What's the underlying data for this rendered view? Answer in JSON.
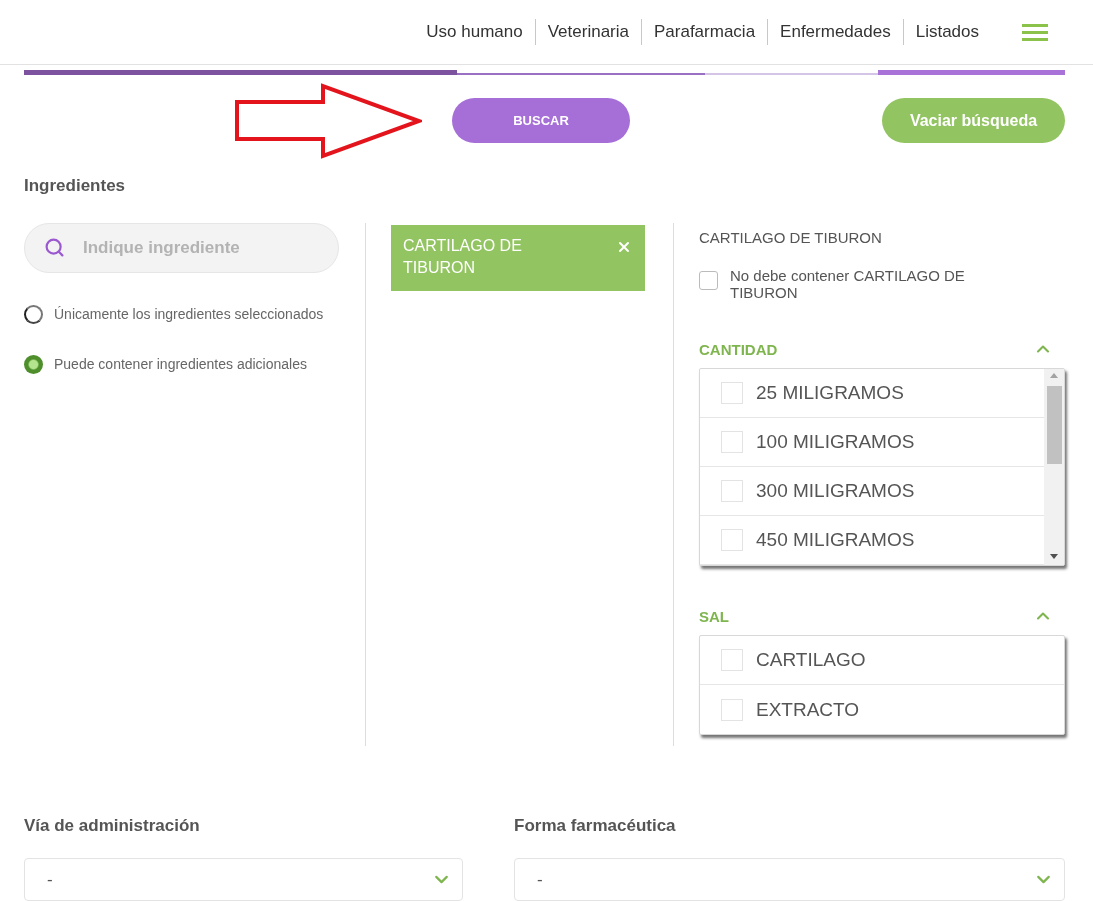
{
  "header": {
    "nav": [
      {
        "label": "Uso humano"
      },
      {
        "label": "Veterinaria"
      },
      {
        "label": "Parafarmacia"
      },
      {
        "label": "Enfermedades"
      },
      {
        "label": "Listados"
      }
    ]
  },
  "tab_strip": [
    {
      "selected": true,
      "color": "#7d539f"
    },
    {
      "selected": false,
      "color": "#9a70c2"
    },
    {
      "selected": false,
      "color": "#d4c4e6"
    },
    {
      "selected": true,
      "color": "#a872d8"
    }
  ],
  "actions": {
    "search_button": "BUSCAR",
    "clear_button": "Vaciar búsqueda"
  },
  "ingredients": {
    "title": "Ingredientes",
    "search": {
      "placeholder": "Indique ingrediente"
    },
    "match_options": [
      {
        "label": "Únicamente los ingredientes seleccionados",
        "selected": false
      },
      {
        "label": "Puede contener ingredientes adicionales",
        "selected": true
      }
    ],
    "chips": [
      {
        "label": "CARTILAGO DE TIBURON"
      }
    ],
    "detail": {
      "title": "CARTILAGO DE TIBURON",
      "exclude": {
        "label": "No debe contener CARTILAGO DE TIBURON",
        "checked": false
      },
      "groups": [
        {
          "title": "CANTIDAD",
          "expanded": true,
          "scrollable": true,
          "options": [
            {
              "label": "25 MILIGRAMOS",
              "checked": false
            },
            {
              "label": "100 MILIGRAMOS",
              "checked": false
            },
            {
              "label": "300 MILIGRAMOS",
              "checked": false
            },
            {
              "label": "450 MILIGRAMOS",
              "checked": false
            }
          ]
        },
        {
          "title": "SAL",
          "expanded": true,
          "scrollable": false,
          "options": [
            {
              "label": "CARTILAGO",
              "checked": false
            },
            {
              "label": "EXTRACTO",
              "checked": false
            }
          ]
        }
      ]
    }
  },
  "filters": [
    {
      "label": "Vía de administración",
      "value": "-"
    },
    {
      "label": "Forma farmacéutica",
      "value": "-"
    }
  ]
}
